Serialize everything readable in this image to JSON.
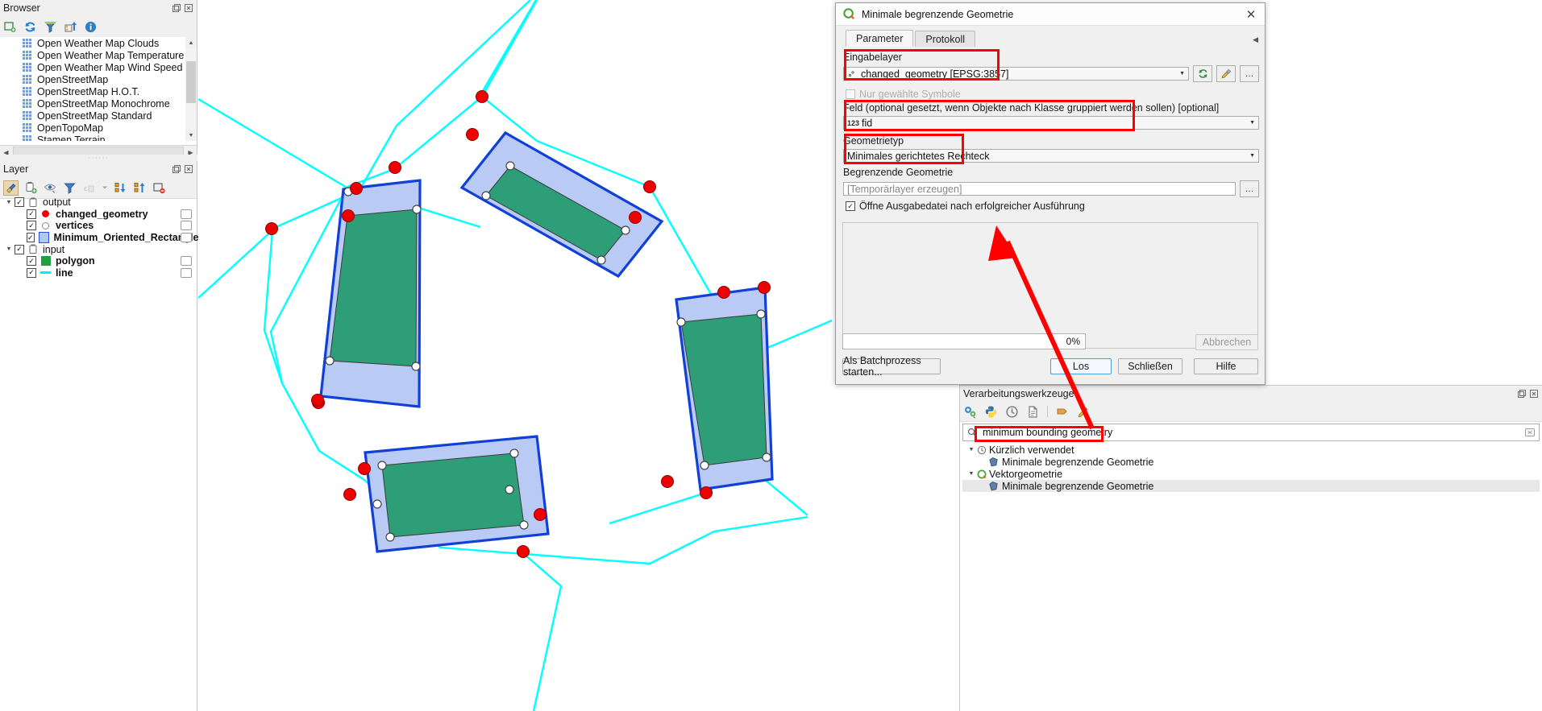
{
  "browser": {
    "title": "Browser",
    "toolbar_icons": [
      "new-collection-icon",
      "refresh-icon",
      "filter-icon",
      "add-layer-icon",
      "info-icon"
    ],
    "items": [
      {
        "label": "Open Weather Map Clouds",
        "icon": "xyz-tiles-icon"
      },
      {
        "label": "Open Weather Map Temperature",
        "icon": "xyz-tiles-icon"
      },
      {
        "label": "Open Weather Map Wind Speed",
        "icon": "xyz-tiles-icon"
      },
      {
        "label": "OpenStreetMap",
        "icon": "xyz-tiles-icon"
      },
      {
        "label": "OpenStreetMap H.O.T.",
        "icon": "xyz-tiles-icon"
      },
      {
        "label": "OpenStreetMap Monochrome",
        "icon": "xyz-tiles-icon"
      },
      {
        "label": "OpenStreetMap Standard",
        "icon": "xyz-tiles-icon"
      },
      {
        "label": "OpenTopoMap",
        "icon": "xyz-tiles-icon"
      },
      {
        "label": "Stamen Terrain",
        "icon": "xyz-tiles-icon"
      }
    ]
  },
  "layers": {
    "title": "Layer",
    "toolbar_icons": [
      "styling-panel-icon",
      "add-group-icon",
      "manage-visibility-icon",
      "filter-legend-icon",
      "expression-filter-icon",
      "expand-all-icon",
      "collapse-all-icon",
      "remove-layer-icon"
    ],
    "tree": [
      {
        "label": "output",
        "type": "group",
        "checked": true,
        "bold": false,
        "indent": 0,
        "symbol": "group-icon"
      },
      {
        "label": "changed_geometry",
        "type": "layer",
        "checked": true,
        "bold": true,
        "indent": 1,
        "symbol": "point-red-icon"
      },
      {
        "label": "vertices",
        "type": "layer",
        "checked": true,
        "bold": true,
        "indent": 1,
        "symbol": "point-hollow-icon"
      },
      {
        "label": "Minimum_Oriented_Rectangle",
        "type": "layer",
        "checked": true,
        "bold": true,
        "indent": 1,
        "symbol": "polygon-blue-icon"
      },
      {
        "label": "input",
        "type": "group",
        "checked": true,
        "bold": false,
        "indent": 0,
        "symbol": "group-icon"
      },
      {
        "label": "polygon",
        "type": "layer",
        "checked": true,
        "bold": true,
        "indent": 1,
        "symbol": "polygon-green-icon"
      },
      {
        "label": "line",
        "type": "layer",
        "checked": true,
        "bold": true,
        "indent": 1,
        "symbol": "line-cyan-icon"
      }
    ]
  },
  "dialog": {
    "title": "Minimale begrenzende Geometrie",
    "logo": "qgis-logo-icon",
    "close_label": "✕",
    "tabs": [
      {
        "label": "Parameter",
        "active": true
      },
      {
        "label": "Protokoll",
        "active": false
      }
    ],
    "input_layer_label": "Eingabelayer",
    "input_layer_value": "changed_geometry [EPSG:3857]",
    "selected_only_label": "Nur gewählte Symbole",
    "selected_only_checked": false,
    "field_label": "Feld (optional gesetzt, wenn Objekte nach Klasse gruppiert werden sollen) [optional]",
    "field_value": "fid",
    "field_type_badge": "123",
    "geometry_type_label": "Geometrietyp",
    "geometry_type_value": "Minimales gerichtetes Rechteck",
    "output_label": "Begrenzende Geometrie",
    "output_placeholder": "[Temporärlayer erzeugen]",
    "open_output_label": "Öffne Ausgabedatei nach erfolgreicher Ausführung",
    "open_output_checked": true,
    "progress_text": "0%",
    "batch_button": "Als Batchprozess starten...",
    "run_button": "Los",
    "close_button": "Schließen",
    "help_button": "Hilfe",
    "cancel_button": "Abbrechen",
    "refresh_icon": "refresh-layer-icon",
    "tool_icon": "advanced-options-icon",
    "ellipsis_icon": "browse-ellipsis-icon"
  },
  "processing": {
    "title": "Verarbeitungswerkzeuge",
    "toolbar_icons": [
      "models-icon",
      "python-icon",
      "history-icon",
      "results-icon",
      "edit-icon",
      "options-icon"
    ],
    "search_value": "minimum bounding geometry",
    "search_icon": "search-icon",
    "clear_icon": "clear-search-icon",
    "tree": [
      {
        "label": "Kürzlich verwendet",
        "indent": 0,
        "icon": "history-icon",
        "selected": false
      },
      {
        "label": "Minimale begrenzende Geometrie",
        "indent": 1,
        "icon": "algorithm-icon",
        "selected": false
      },
      {
        "label": "Vektorgeometrie",
        "indent": 0,
        "icon": "qgis-logo-icon",
        "selected": false
      },
      {
        "label": "Minimale begrenzende Geometrie",
        "indent": 1,
        "icon": "algorithm-icon",
        "selected": true
      }
    ]
  },
  "annotations": {
    "arrow_color": "#ff0000",
    "highlight_color": "#ff0000"
  },
  "map": {
    "colors": {
      "polygon_fill": "#2e9e78",
      "rect_fill": "#b9cbf5",
      "rect_stroke": "#1040d8",
      "line": "#00ffff",
      "vertex_red": "#ee0000",
      "vertex_white": "#ffffff"
    }
  }
}
